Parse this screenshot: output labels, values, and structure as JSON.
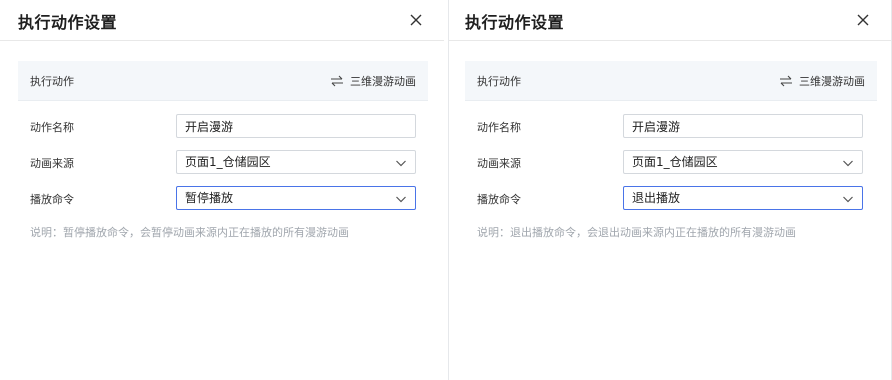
{
  "panels": [
    {
      "title": "执行动作设置",
      "action_label": "执行动作",
      "action_type": "三维漫游动画",
      "fields": [
        {
          "label": "动作名称",
          "value": "开启漫游"
        },
        {
          "label": "动画来源",
          "value": "页面1_仓储园区"
        },
        {
          "label": "播放命令",
          "value": "暂停播放"
        }
      ],
      "help": "说明：暂停播放命令，会暂停动画来源内正在播放的所有漫游动画"
    },
    {
      "title": "执行动作设置",
      "action_label": "执行动作",
      "action_type": "三维漫游动画",
      "fields": [
        {
          "label": "动作名称",
          "value": "开启漫游"
        },
        {
          "label": "动画来源",
          "value": "页面1_仓储园区"
        },
        {
          "label": "播放命令",
          "value": "退出播放"
        }
      ],
      "help": "说明：退出播放命令，会退出动画来源内正在播放的所有漫游动画"
    }
  ],
  "icons": {
    "close": "close-icon",
    "swap": "swap-arrows-icon",
    "dropdown": "chevron-down-icon"
  },
  "colors": {
    "accent_border": "#4a74e8",
    "action_bar_bg": "#f4f7fa",
    "help_text": "#a0a6ad"
  }
}
